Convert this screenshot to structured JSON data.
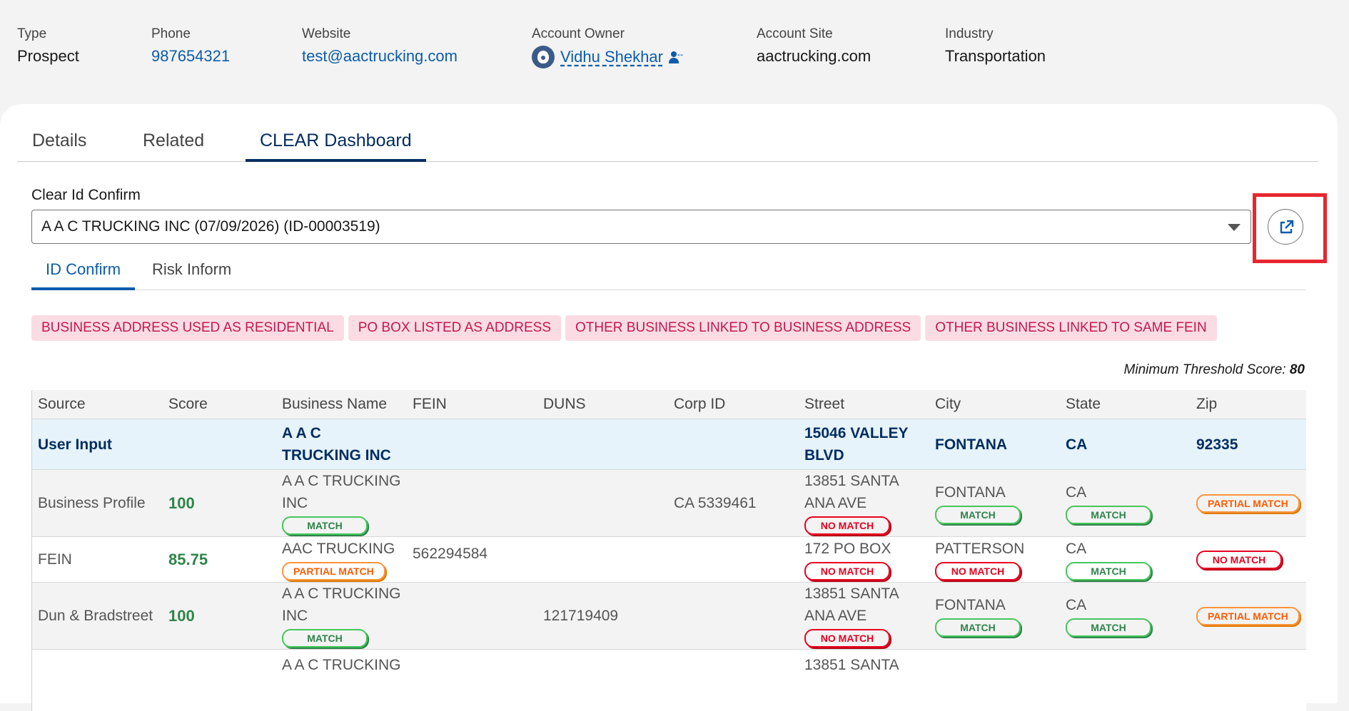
{
  "highlights": {
    "type": {
      "label": "Type",
      "value": "Prospect"
    },
    "phone": {
      "label": "Phone",
      "value": "987654321"
    },
    "website": {
      "label": "Website",
      "value": "test@aactrucking.com"
    },
    "owner": {
      "label": "Account Owner",
      "value": "Vidhu Shekhar"
    },
    "site": {
      "label": "Account Site",
      "value": "aactrucking.com"
    },
    "industry": {
      "label": "Industry",
      "value": "Transportation"
    }
  },
  "tabs": {
    "details": "Details",
    "related": "Related",
    "clear": "CLEAR Dashboard"
  },
  "clear_id": {
    "label": "Clear Id Confirm",
    "selected": "A A C TRUCKING INC (07/09/2026) (ID-00003519)"
  },
  "subtabs": {
    "id_confirm": "ID Confirm",
    "risk_inform": "Risk Inform"
  },
  "flags": [
    "BUSINESS ADDRESS USED AS RESIDENTIAL",
    "PO BOX LISTED AS ADDRESS",
    "OTHER BUSINESS LINKED TO BUSINESS ADDRESS",
    "OTHER BUSINESS LINKED TO SAME FEIN"
  ],
  "threshold": {
    "label": "Minimum Threshold Score:",
    "value": "80"
  },
  "table": {
    "columns": [
      "Source",
      "Score",
      "Business Name",
      "FEIN",
      "DUNS",
      "Corp ID",
      "Street",
      "City",
      "State",
      "Zip"
    ],
    "user_input": {
      "source": "User Input",
      "business_name": "A A C TRUCKING INC",
      "street": "15046 VALLEY BLVD",
      "city": "FONTANA",
      "state": "CA",
      "zip": "92335"
    },
    "rows": [
      {
        "source": "Business Profile",
        "score": "100",
        "business_name": "A A C TRUCKING INC",
        "business_name_status": "MATCH",
        "fein": "",
        "duns": "",
        "corp_id": "CA 5339461",
        "street": "13851 SANTA ANA AVE",
        "street_status": "NO MATCH",
        "city": "FONTANA",
        "city_status": "MATCH",
        "state": "CA",
        "state_status": "MATCH",
        "zip_status": "PARTIAL MATCH"
      },
      {
        "source": "FEIN",
        "score": "85.75",
        "business_name": "AAC TRUCKING",
        "business_name_status": "PARTIAL MATCH",
        "fein": "562294584",
        "duns": "",
        "corp_id": "",
        "street": "172 PO BOX",
        "street_status": "NO MATCH",
        "city": "PATTERSON",
        "city_status": "NO MATCH",
        "state": "CA",
        "state_status": "MATCH",
        "zip_status": "NO MATCH"
      },
      {
        "source": "Dun & Bradstreet",
        "score": "100",
        "business_name": "A A C TRUCKING INC",
        "business_name_status": "MATCH",
        "fein": "",
        "duns": "121719409",
        "corp_id": "",
        "street": "13851 SANTA ANA AVE",
        "street_status": "NO MATCH",
        "city": "FONTANA",
        "city_status": "MATCH",
        "state": "CA",
        "state_status": "MATCH",
        "zip_status": "PARTIAL MATCH"
      },
      {
        "source": "",
        "score": "",
        "business_name": "A A C TRUCKING",
        "business_name_status": "",
        "fein": "",
        "duns": "",
        "corp_id": "",
        "street": "13851 SANTA",
        "street_status": "",
        "city": "",
        "city_status": "",
        "state": "",
        "state_status": "",
        "zip_status": ""
      }
    ]
  },
  "colors": {
    "accent": "#0b5cab",
    "brand_dark": "#032d60",
    "flag_bg": "#fbdce4",
    "flag_text": "#c4184e",
    "match": "#2e844a",
    "no_match": "#ea001e",
    "partial": "#fe5c01",
    "highlight_box": "#e8262e"
  },
  "icons": {
    "popout": "new-window-icon",
    "caret": "chevron-down-icon",
    "owner_change": "change-owner-icon",
    "avatar": "user-avatar-icon"
  }
}
